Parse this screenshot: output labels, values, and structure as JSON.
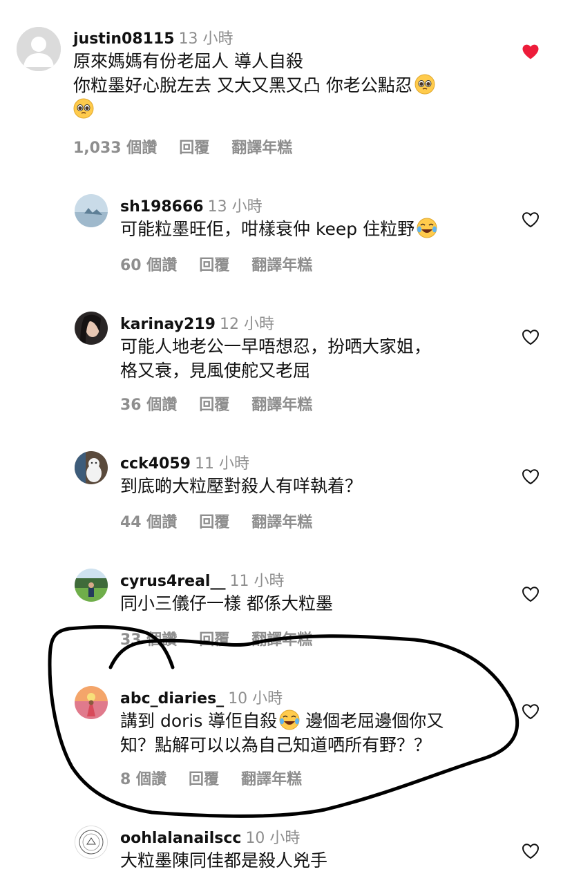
{
  "comments": [
    {
      "username": "justin08115",
      "time": "13 小時",
      "line1": "原來媽媽有份老屈人 導人自殺",
      "line2": "你粒墨好心脫左去 又大又黑又凸 你老公點忍",
      "likes": "1,033 個讚",
      "reply": "回覆",
      "translate": "翻譯年糕",
      "liked": true,
      "emoji": "pleading-face-emoji"
    },
    {
      "username": "sh198666",
      "time": "13 小時",
      "line1": "可能粒墨旺佢，咁樣衰仲 keep 住粒野",
      "likes": "60 個讚",
      "reply": "回覆",
      "translate": "翻譯年糕",
      "emoji": "tears-of-joy-emoji"
    },
    {
      "username": "karinay219",
      "time": "12 小時",
      "line1": "可能人地老公一早唔想忍，扮哂大家姐，",
      "line2": "格又衰，見風使舵又老屈",
      "likes": "36 個讚",
      "reply": "回覆",
      "translate": "翻譯年糕"
    },
    {
      "username": "cck4059",
      "time": "11 小時",
      "line1": "到底啲大粒壓對殺人有咩執着？",
      "likes": "44 個讚",
      "reply": "回覆",
      "translate": "翻譯年糕"
    },
    {
      "username": "cyrus4real__",
      "time": "11 小時",
      "line1": "同小三儀仔一樣 都係大粒墨",
      "likes": "33 個讚",
      "reply": "回覆",
      "translate": "翻譯年糕"
    },
    {
      "username": "abc_diaries_",
      "time": "10 小時",
      "line1a": "講到 doris 導佢自殺",
      "line1b": " 邊個老屈邊個你又",
      "line2": "知？點解可以以為自己知道哂所有野？？",
      "likes": "8 個讚",
      "reply": "回覆",
      "translate": "翻譯年糕",
      "emoji": "tears-of-joy-emoji"
    },
    {
      "username": "oohlalanailscc",
      "time": "10 小時",
      "line1": "大粒墨陳同佳都是殺人兇手"
    }
  ],
  "colors": {
    "text": "#111111",
    "muted": "#8e8e8e",
    "like_red": "#ed1c3a",
    "annotation": "#000000"
  },
  "icons": {
    "liked": "heart-filled-icon",
    "unliked": "heart-outline-icon",
    "default_avatar": "default-avatar-icon"
  }
}
